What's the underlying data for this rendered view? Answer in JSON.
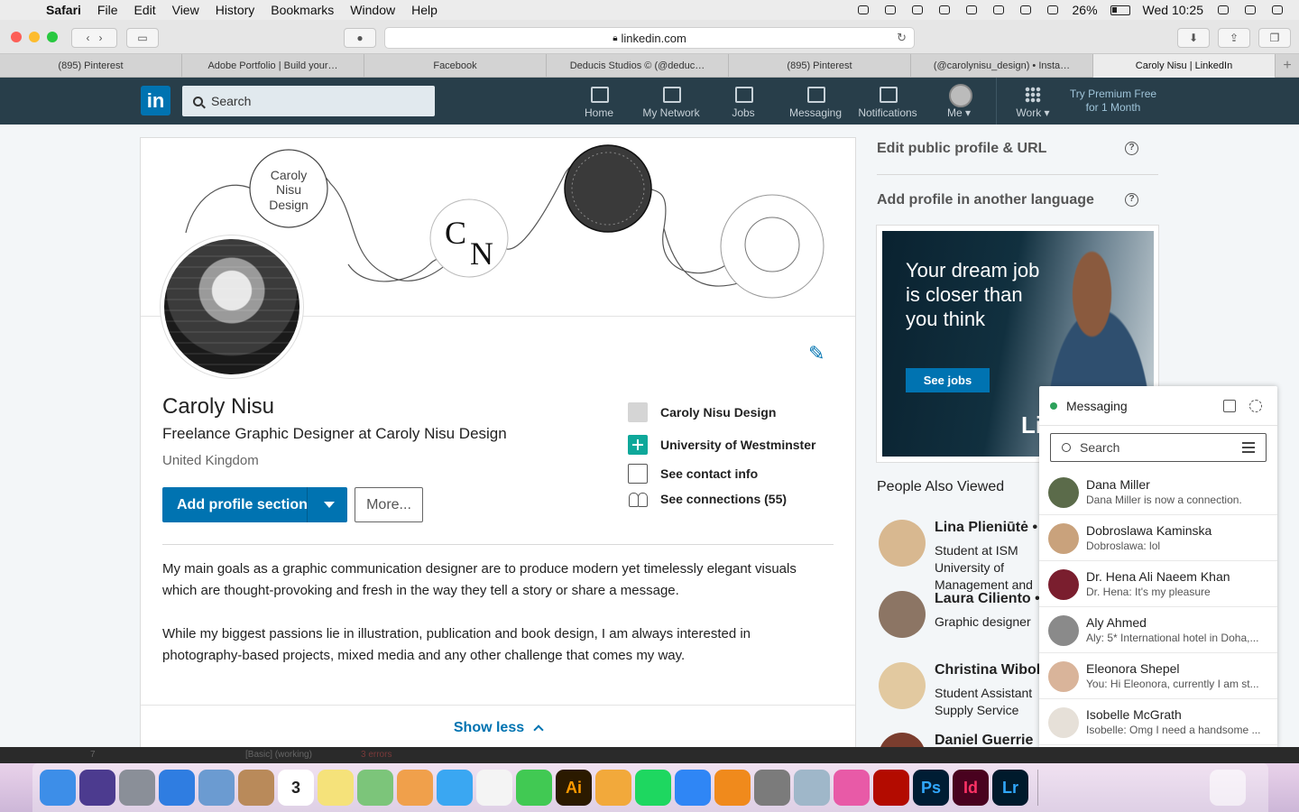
{
  "menubar": {
    "app": "Safari",
    "items": [
      "File",
      "Edit",
      "View",
      "History",
      "Bookmarks",
      "Window",
      "Help"
    ],
    "battery": "26%",
    "clock": "Wed 10:25"
  },
  "browser": {
    "url": "linkedin.com",
    "tabs": [
      "(895) Pinterest",
      "Adobe Portfolio | Build your…",
      "Facebook",
      "Deducis Studios © (@deduc…",
      "(895) Pinterest",
      "(@carolynisu_design) • Insta…",
      "Caroly Nisu | LinkedIn"
    ],
    "active_tab": 6,
    "new_tab": "+"
  },
  "linkedin_nav": {
    "logo": "in",
    "search_placeholder": "Search",
    "items": [
      {
        "label": "Home",
        "icon": "home-icon"
      },
      {
        "label": "My Network",
        "icon": "network-icon"
      },
      {
        "label": "Jobs",
        "icon": "briefcase-icon"
      },
      {
        "label": "Messaging",
        "icon": "messaging-icon"
      },
      {
        "label": "Notifications",
        "icon": "bell-icon"
      },
      {
        "label": "Me",
        "icon": "avatar-icon"
      },
      {
        "label": "Work",
        "icon": "grid-icon"
      }
    ],
    "premium_line1": "Try Premium Free",
    "premium_line2": "for 1 Month"
  },
  "profile": {
    "banner_text": {
      "top": "Caroly",
      "middle": "Nisu",
      "bottom": "Design",
      "monogram_c": "C",
      "monogram_n": "N"
    },
    "name": "Caroly Nisu",
    "headline": "Freelance Graphic Designer at Caroly Nisu Design",
    "location": "United Kingdom",
    "add_section_label": "Add profile section",
    "more_label": "More...",
    "company": "Caroly Nisu Design",
    "school": "University of Westminster",
    "contact": "See contact info",
    "connections": "See connections (55)",
    "summary_p1": "My main goals as a graphic communication designer are to produce modern yet timelessly elegant visuals which are thought-provoking and fresh in the way they tell a story or share a message.",
    "summary_p2": "While my biggest passions lie in illustration, publication and book design, I am always interested in photography-based projects, mixed media and any other challenge that comes my way.",
    "show_less": "Show less"
  },
  "rail": {
    "edit_public": "Edit public profile & URL",
    "another_lang": "Add profile in another language",
    "ad_text": "Your dream job is closer than you think",
    "ad_cta": "See jobs",
    "ad_brand": "Li",
    "pav_title": "People Also Viewed",
    "pav": [
      {
        "name": "Lina Plieniūtė •",
        "desc": "Student at ISM University of Management and"
      },
      {
        "name": "Laura Ciliento •",
        "desc": "Graphic designer"
      },
      {
        "name": "Christina Wibol",
        "desc": "Student Assistant Supply Service"
      },
      {
        "name": "Daniel Guerrie",
        "desc": ""
      }
    ]
  },
  "messaging": {
    "title": "Messaging",
    "search_placeholder": "Search",
    "conversations": [
      {
        "name": "Dana Miller",
        "preview": "Dana Miller is now a connection."
      },
      {
        "name": "Dobroslawa Kaminska",
        "preview": "Dobroslawa: lol"
      },
      {
        "name": "Dr. Hena Ali Naeem Khan",
        "preview": "Dr. Hena: It's my pleasure"
      },
      {
        "name": "Aly Ahmed",
        "preview": "Aly: 5* International hotel in Doha,..."
      },
      {
        "name": "Eleonora Shepel",
        "preview": "You: Hi Eleonora, currently I am st..."
      },
      {
        "name": "Isobelle McGrath",
        "preview": "Isobelle: Omg I need a handsome ..."
      }
    ]
  },
  "statusbar": {
    "mode": "[Basic] (working)",
    "errors": "3 errors",
    "page": "7"
  },
  "dock": {
    "apps": [
      {
        "name": "finder",
        "label": "",
        "color": "#3d8ee8"
      },
      {
        "name": "siri",
        "label": "",
        "color": "#4c3b8f"
      },
      {
        "name": "launchpad",
        "label": "",
        "color": "#8a8f98"
      },
      {
        "name": "safari",
        "label": "",
        "color": "#2f7de1"
      },
      {
        "name": "preview",
        "label": "",
        "color": "#6b9bd1"
      },
      {
        "name": "contacts",
        "label": "",
        "color": "#b98a5a"
      },
      {
        "name": "calendar",
        "label": "3",
        "color": "#ffffff"
      },
      {
        "name": "notes",
        "label": "",
        "color": "#f5e27a"
      },
      {
        "name": "maps",
        "label": "",
        "color": "#7cc57a"
      },
      {
        "name": "photos",
        "label": "",
        "color": "#f0a04b"
      },
      {
        "name": "messages",
        "label": "",
        "color": "#3aa7f2"
      },
      {
        "name": "reminders",
        "label": "",
        "color": "#f4f4f4"
      },
      {
        "name": "facetime",
        "label": "",
        "color": "#41c953"
      },
      {
        "name": "illustrator",
        "label": "Ai",
        "color": "#2b1a00"
      },
      {
        "name": "pages",
        "label": "",
        "color": "#f2a93b"
      },
      {
        "name": "spotify",
        "label": "",
        "color": "#1ed760"
      },
      {
        "name": "app-store",
        "label": "",
        "color": "#2f86f5"
      },
      {
        "name": "books",
        "label": "",
        "color": "#f08a1c"
      },
      {
        "name": "system-preferences",
        "label": "",
        "color": "#7b7b7b"
      },
      {
        "name": "image-capture",
        "label": "",
        "color": "#9fb7c9"
      },
      {
        "name": "itunes",
        "label": "",
        "color": "#e85aa7"
      },
      {
        "name": "acrobat",
        "label": "",
        "color": "#b30b00"
      },
      {
        "name": "photoshop",
        "label": "Ps",
        "color": "#001d34"
      },
      {
        "name": "indesign",
        "label": "Id",
        "color": "#49021f"
      },
      {
        "name": "lightroom",
        "label": "Lr",
        "color": "#001a2c"
      }
    ],
    "trash": "trash"
  }
}
